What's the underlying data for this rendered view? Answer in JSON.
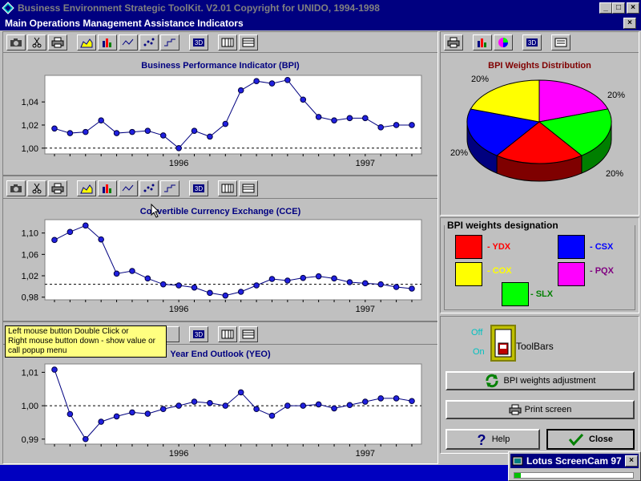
{
  "window": {
    "title": "Business Environment Strategic ToolKit. V2.01 Copyright for UNIDO, 1994-1998",
    "subtitle": "Main Operations Management Assistance Indicators"
  },
  "charts": [
    {
      "id": "bpi",
      "title": "Business Performance Indicator (BPI)",
      "yticks": [
        "1,04",
        "1,02",
        "1,00"
      ],
      "xticks": [
        "1996",
        "1997"
      ]
    },
    {
      "id": "cce",
      "title": "Convertible Currency Exchange (CCE)",
      "yticks": [
        "1,10",
        "1,06",
        "1,02",
        "0,98"
      ],
      "xticks": [
        "1996",
        "1997"
      ]
    },
    {
      "id": "yeo",
      "title": "Year End Outlook (YEO)",
      "yticks": [
        "1,01",
        "1,00",
        "0,99"
      ],
      "xticks": [
        "1996",
        "1997"
      ]
    }
  ],
  "chart_data": [
    {
      "type": "line",
      "title": "Business Performance Indicator (BPI)",
      "ylim": [
        0.995,
        1.063
      ],
      "reference_line": 1.0,
      "values": [
        1.017,
        1.013,
        1.014,
        1.024,
        1.013,
        1.014,
        1.015,
        1.011,
        1.0,
        1.015,
        1.01,
        1.021,
        1.05,
        1.058,
        1.056,
        1.059,
        1.042,
        1.027,
        1.024,
        1.026,
        1.026,
        1.018,
        1.02,
        1.02
      ]
    },
    {
      "type": "line",
      "title": "Convertible Currency Exchange (CCE)",
      "ylim": [
        0.975,
        1.125
      ],
      "reference_line": 1.004,
      "values": [
        1.087,
        1.102,
        1.114,
        1.088,
        1.024,
        1.029,
        1.015,
        1.004,
        1.002,
        0.998,
        0.988,
        0.983,
        0.99,
        1.002,
        1.014,
        1.011,
        1.016,
        1.019,
        1.015,
        1.008,
        1.006,
        1.004,
        0.999,
        0.996
      ]
    },
    {
      "type": "line",
      "title": "Year End Outlook (YEO)",
      "ylim": [
        0.9885,
        1.0125
      ],
      "reference_line": 1.0,
      "values": [
        1.0108,
        0.9975,
        0.99,
        0.9952,
        0.9968,
        0.998,
        0.9976,
        0.999,
        1.0,
        1.0012,
        1.0008,
        1.0,
        1.004,
        0.999,
        0.997,
        1.0,
        1.0,
        1.0004,
        0.9992,
        1.0002,
        1.0012,
        1.0022,
        1.0022,
        1.0014
      ]
    },
    {
      "type": "pie",
      "title": "BPI Weights Distribution",
      "labels": [
        "YDX",
        "COX",
        "SLX",
        "CSX",
        "PQX"
      ],
      "values": [
        20,
        20,
        20,
        20,
        20
      ],
      "slice_labels": [
        "20%",
        "20%",
        "20%",
        "20%",
        "20%"
      ],
      "colors": [
        "#ff0000",
        "#ffff00",
        "#00ff00",
        "#0000ff",
        "#ff00ff"
      ]
    }
  ],
  "pie": {
    "title": "BPI Weights Distribution"
  },
  "legend": {
    "title": "BPI weights designation",
    "items": [
      {
        "label": "- YDX",
        "color": "#ff0000",
        "text_color": "#ff0000"
      },
      {
        "label": "- CSX",
        "color": "#0000ff",
        "text_color": "#0000ff"
      },
      {
        "label": "- COX",
        "color": "#ffff00",
        "text_color": "#ffff00"
      },
      {
        "label": "- PQX",
        "color": "#ff00ff",
        "text_color": "#800080"
      },
      {
        "label": "- SLX",
        "color": "#00ff00",
        "text_color": "#008000"
      }
    ]
  },
  "toolbars": {
    "off_label": "Off",
    "on_label": "On",
    "switch_label": "ToolBars"
  },
  "buttons": {
    "weights": "BPI weights adjustment",
    "print": "Print screen",
    "help": "Help",
    "close": "Close"
  },
  "tooltip": {
    "lines": [
      "Left mouse button Double Click or",
      "Right mouse button down - show value or",
      "call popup menu"
    ]
  },
  "screencam": {
    "title": "Lotus ScreenCam 97"
  },
  "colors": {
    "titlebar": "#000080",
    "line": "#000080",
    "point": "#2020e0",
    "pie_title": "#800000"
  }
}
